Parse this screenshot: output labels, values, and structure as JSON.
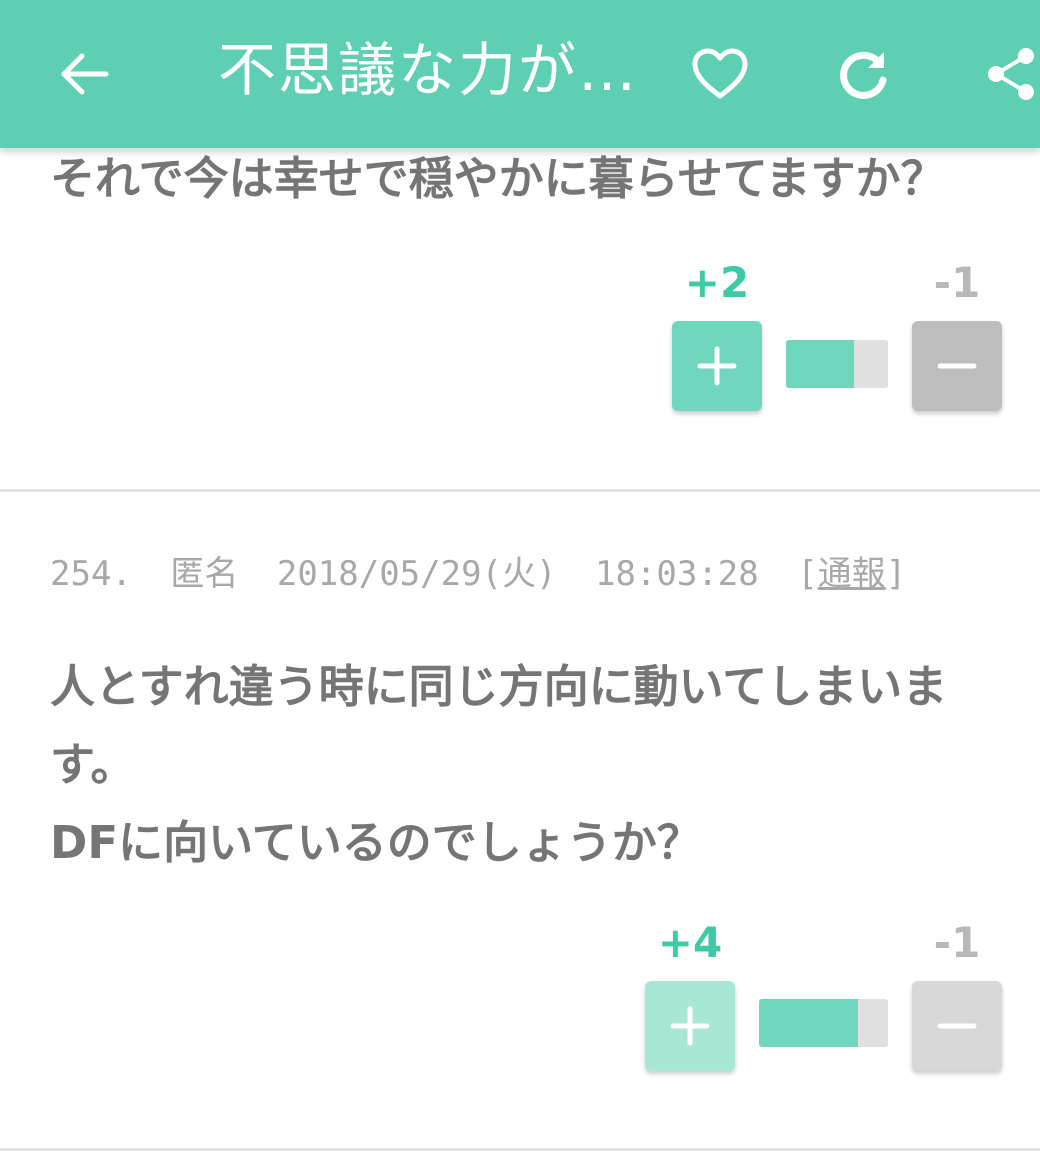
{
  "appbar": {
    "title": "不思議な力が…",
    "back_icon": "arrow-left-icon",
    "favorite_icon": "heart-icon",
    "reload_icon": "refresh-icon",
    "share_icon": "share-icon"
  },
  "posts": [
    {
      "body_lines": [
        "それで今は幸せで穏やかに暮らせてますか？"
      ],
      "plus_count": "+2",
      "minus_count": "-1",
      "plus_label": "+",
      "minus_label": "−",
      "ratio": 0.67
    },
    {
      "number": "254.",
      "author": "匿名",
      "date": "2018/05/29(火)",
      "time": "18:03:28",
      "report_open": "[",
      "report_label": "通報",
      "report_close": "]",
      "body_lines": [
        "人とすれ違う時に同じ方向に動いてしまいま",
        "す。",
        "DFに向いているのでしょうか？"
      ],
      "plus_count": "+4",
      "minus_count": "-1",
      "plus_label": "+",
      "minus_label": "−",
      "ratio": 0.77
    }
  ],
  "colors": {
    "accent": "#5ecfb2",
    "plus": "#3fcaa6",
    "minus": "#b8b8b8",
    "text": "#757575"
  }
}
